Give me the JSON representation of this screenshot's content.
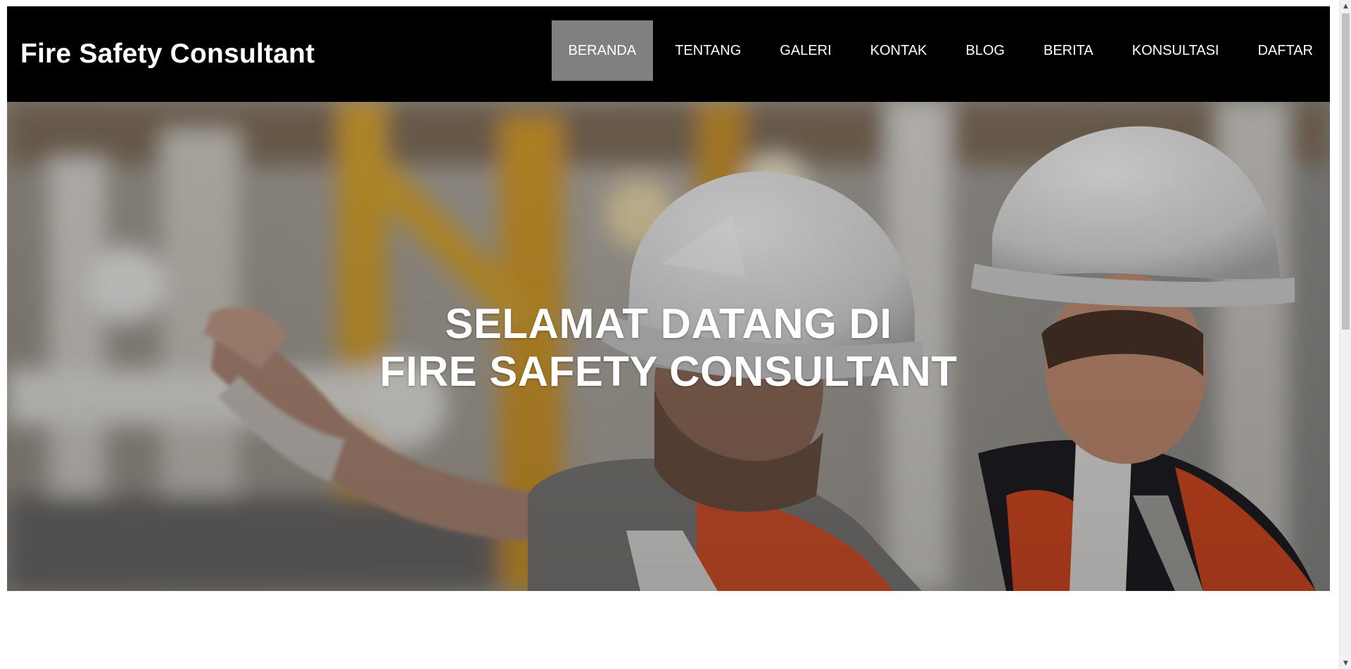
{
  "header": {
    "brand": "Fire Safety Consultant",
    "nav": [
      {
        "label": "BERANDA",
        "active": true
      },
      {
        "label": "TENTANG",
        "active": false
      },
      {
        "label": "GALERI",
        "active": false
      },
      {
        "label": "KONTAK",
        "active": false
      },
      {
        "label": "BLOG",
        "active": false
      },
      {
        "label": "BERITA",
        "active": false
      },
      {
        "label": "KONSULTASI",
        "active": false
      },
      {
        "label": "DAFTAR",
        "active": false
      }
    ]
  },
  "hero": {
    "title_line1": "SELAMAT DATANG DI",
    "title_line2": "FIRE SAFETY CONSULTANT"
  },
  "colors": {
    "header_bg": "#000000",
    "active_nav_bg": "#808080",
    "text": "#ffffff"
  },
  "scrollbar": {
    "up_icon": "triangle-up-icon",
    "down_icon": "triangle-down-icon"
  }
}
